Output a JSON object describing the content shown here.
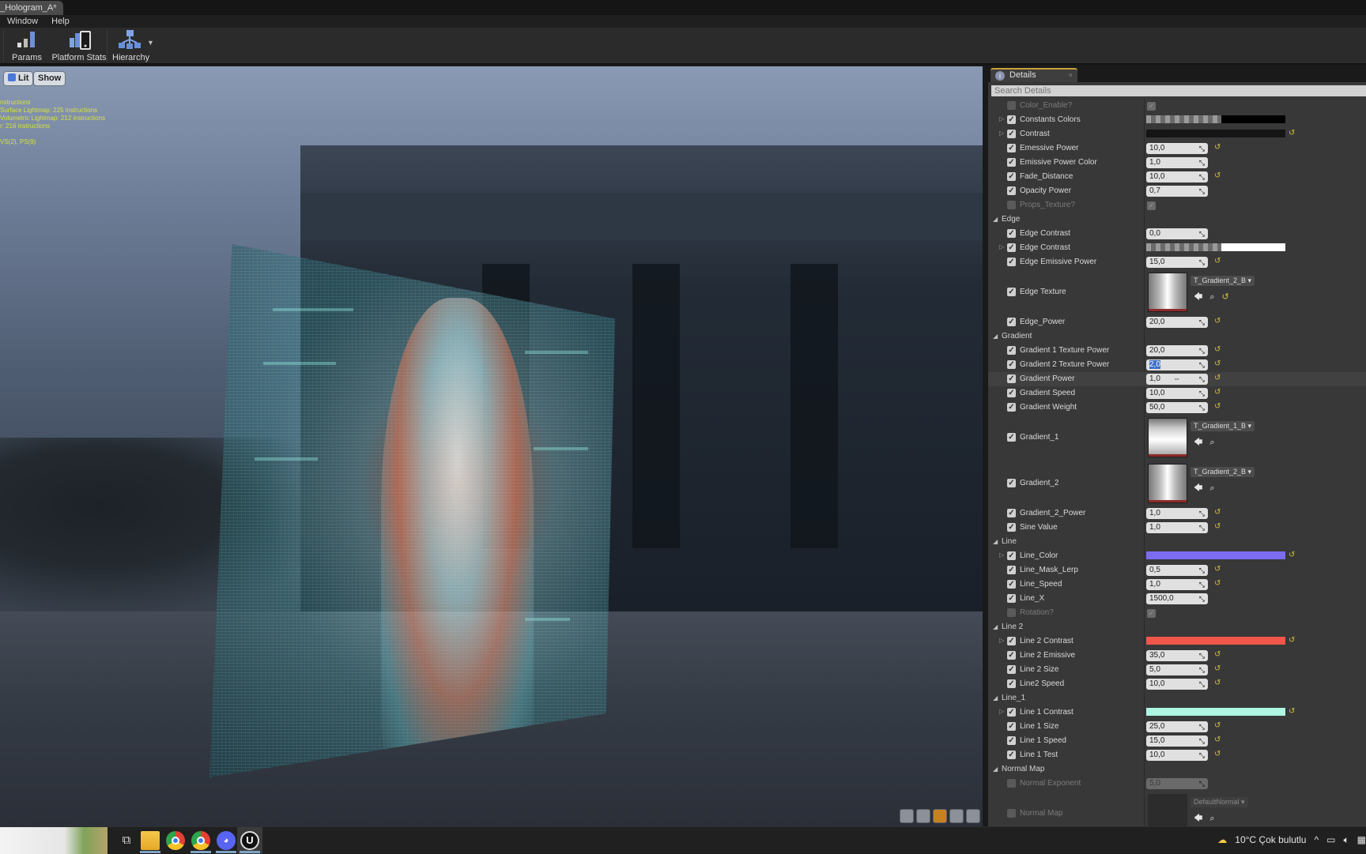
{
  "window": {
    "tab_title": "_Hologram_A*",
    "tab_close": "×"
  },
  "menu": [
    "Window",
    "Help"
  ],
  "toolbar": {
    "buttons": [
      {
        "label": "Params",
        "icon": "params-bar-chart-icon"
      },
      {
        "label": "Platform Stats",
        "icon": "platform-stats-icon"
      },
      {
        "label": "Hierarchy",
        "icon": "hierarchy-icon",
        "has_dropdown": true
      }
    ]
  },
  "viewport": {
    "lit_button": "Lit",
    "show_button": "Show",
    "stats_lines": [
      "nstructions",
      "Surface Lightmap: 225 instructions",
      "Volumetric Lightmap: 212 instructions",
      "r: 216 instructions",
      "",
      "VS(2), PS(9)"
    ],
    "view_modes": [
      "perspective-cube",
      "sphere",
      "plane",
      "cube",
      "cylinder"
    ],
    "active_view_mode": "plane"
  },
  "details": {
    "tab_label": "Details",
    "search_placeholder": "Search Details",
    "rows": [
      {
        "type": "prop",
        "name": "Color_Enable?",
        "enabled": false,
        "kind": "bool",
        "value": true
      },
      {
        "type": "prop",
        "name": "Constants Colors",
        "enabled": true,
        "expandable": true,
        "kind": "color",
        "swatch": "checker",
        "tail": "#000000"
      },
      {
        "type": "prop",
        "name": "Contrast",
        "enabled": true,
        "expandable": true,
        "kind": "color",
        "swatch": "#151515",
        "reset": true
      },
      {
        "type": "prop",
        "name": "Emessive Power",
        "enabled": true,
        "kind": "number",
        "value": "10,0",
        "reset": true
      },
      {
        "type": "prop",
        "name": "Emissive Power Color",
        "enabled": true,
        "kind": "number",
        "value": "1,0"
      },
      {
        "type": "prop",
        "name": "Fade_Distance",
        "enabled": true,
        "kind": "number",
        "value": "10,0",
        "reset": true
      },
      {
        "type": "prop",
        "name": "Opacity Power",
        "enabled": true,
        "kind": "number",
        "value": "0,7"
      },
      {
        "type": "prop",
        "name": "Props_Texture?",
        "enabled": false,
        "kind": "bool",
        "value": true
      },
      {
        "type": "category",
        "name": "Edge"
      },
      {
        "type": "prop",
        "name": "Edge Contrast",
        "enabled": true,
        "kind": "number",
        "value": "0,0"
      },
      {
        "type": "prop",
        "name": "Edge Contrast",
        "enabled": true,
        "expandable": true,
        "kind": "color",
        "swatch": "checker",
        "tail": "#ffffff"
      },
      {
        "type": "prop",
        "name": "Edge Emissive Power",
        "enabled": true,
        "kind": "number",
        "value": "15,0",
        "reset": true
      },
      {
        "type": "prop",
        "name": "Edge Texture",
        "enabled": true,
        "kind": "texture",
        "asset": "T_Gradient_2_B",
        "thumb": "vertical",
        "reset": true
      },
      {
        "type": "prop",
        "name": "Edge_Power",
        "enabled": true,
        "kind": "number",
        "value": "20,0",
        "reset": true
      },
      {
        "type": "category",
        "name": "Gradient"
      },
      {
        "type": "prop",
        "name": "Gradient 1 Texture Power",
        "enabled": true,
        "kind": "number",
        "value": "20,0",
        "reset": true
      },
      {
        "type": "prop",
        "name": "Gradient 2 Texture Power",
        "enabled": true,
        "kind": "number",
        "value": "2,0",
        "reset": true,
        "editing": true
      },
      {
        "type": "prop",
        "name": "Gradient Power",
        "enabled": true,
        "kind": "number",
        "value": "1,0",
        "reset": true,
        "hovered": true
      },
      {
        "type": "prop",
        "name": "Gradient Speed",
        "enabled": true,
        "kind": "number",
        "value": "10,0",
        "reset": true
      },
      {
        "type": "prop",
        "name": "Gradient Weight",
        "enabled": true,
        "kind": "number",
        "value": "50,0",
        "reset": true
      },
      {
        "type": "prop",
        "name": "Gradient_1",
        "enabled": true,
        "kind": "texture",
        "asset": "T_Gradient_1_B",
        "thumb": "horizontal"
      },
      {
        "type": "prop",
        "name": "Gradient_2",
        "enabled": true,
        "kind": "texture",
        "asset": "T_Gradient_2_B",
        "thumb": "vertical"
      },
      {
        "type": "prop",
        "name": "Gradient_2_Power",
        "enabled": true,
        "kind": "number",
        "value": "1,0",
        "reset": true
      },
      {
        "type": "prop",
        "name": "Sine Value",
        "enabled": true,
        "kind": "number",
        "value": "1,0",
        "reset": true
      },
      {
        "type": "category",
        "name": "Line"
      },
      {
        "type": "prop",
        "name": "Line_Color",
        "enabled": true,
        "expandable": true,
        "kind": "color",
        "swatch": "#7b6cf0",
        "reset": true
      },
      {
        "type": "prop",
        "name": "Line_Mask_Lerp",
        "enabled": true,
        "kind": "number",
        "value": "0,5",
        "reset": true
      },
      {
        "type": "prop",
        "name": "Line_Speed",
        "enabled": true,
        "kind": "number",
        "value": "1,0",
        "reset": true
      },
      {
        "type": "prop",
        "name": "Line_X",
        "enabled": true,
        "kind": "number",
        "value": "1500,0"
      },
      {
        "type": "prop",
        "name": "Rotation?",
        "enabled": false,
        "kind": "bool",
        "value": true
      },
      {
        "type": "category",
        "name": "Line 2"
      },
      {
        "type": "prop",
        "name": "Line 2 Contrast",
        "enabled": true,
        "expandable": true,
        "kind": "color",
        "swatch": "#f0574a",
        "reset": true
      },
      {
        "type": "prop",
        "name": "Line 2 Emissive",
        "enabled": true,
        "kind": "number",
        "value": "35,0",
        "reset": true
      },
      {
        "type": "prop",
        "name": "Line 2 Size",
        "enabled": true,
        "kind": "number",
        "value": "5,0",
        "reset": true
      },
      {
        "type": "prop",
        "name": "Line2 Speed",
        "enabled": true,
        "kind": "number",
        "value": "10,0",
        "reset": true
      },
      {
        "type": "category",
        "name": "Line_1"
      },
      {
        "type": "prop",
        "name": "Line 1 Contrast",
        "enabled": true,
        "expandable": true,
        "kind": "color",
        "swatch": "#aef5e2",
        "reset": true
      },
      {
        "type": "prop",
        "name": "Line 1 Size",
        "enabled": true,
        "kind": "number",
        "value": "25,0",
        "reset": true
      },
      {
        "type": "prop",
        "name": "Line 1 Speed",
        "enabled": true,
        "kind": "number",
        "value": "15,0",
        "reset": true
      },
      {
        "type": "prop",
        "name": "Line 1 Test",
        "enabled": true,
        "kind": "number",
        "value": "10,0",
        "reset": true
      },
      {
        "type": "category",
        "name": "Normal Map"
      },
      {
        "type": "prop",
        "name": "Normal Exponent",
        "enabled": false,
        "kind": "number",
        "value": "5,0"
      },
      {
        "type": "prop",
        "name": "Normal Map",
        "enabled": false,
        "kind": "texture",
        "asset": "DefaultNormal",
        "thumb": "empty"
      }
    ]
  },
  "taskbar": {
    "apps": [
      "task-view",
      "file-explorer",
      "chrome",
      "chrome",
      "discord",
      "unreal-engine"
    ],
    "weather": "10°C  Çok bulutlu"
  }
}
